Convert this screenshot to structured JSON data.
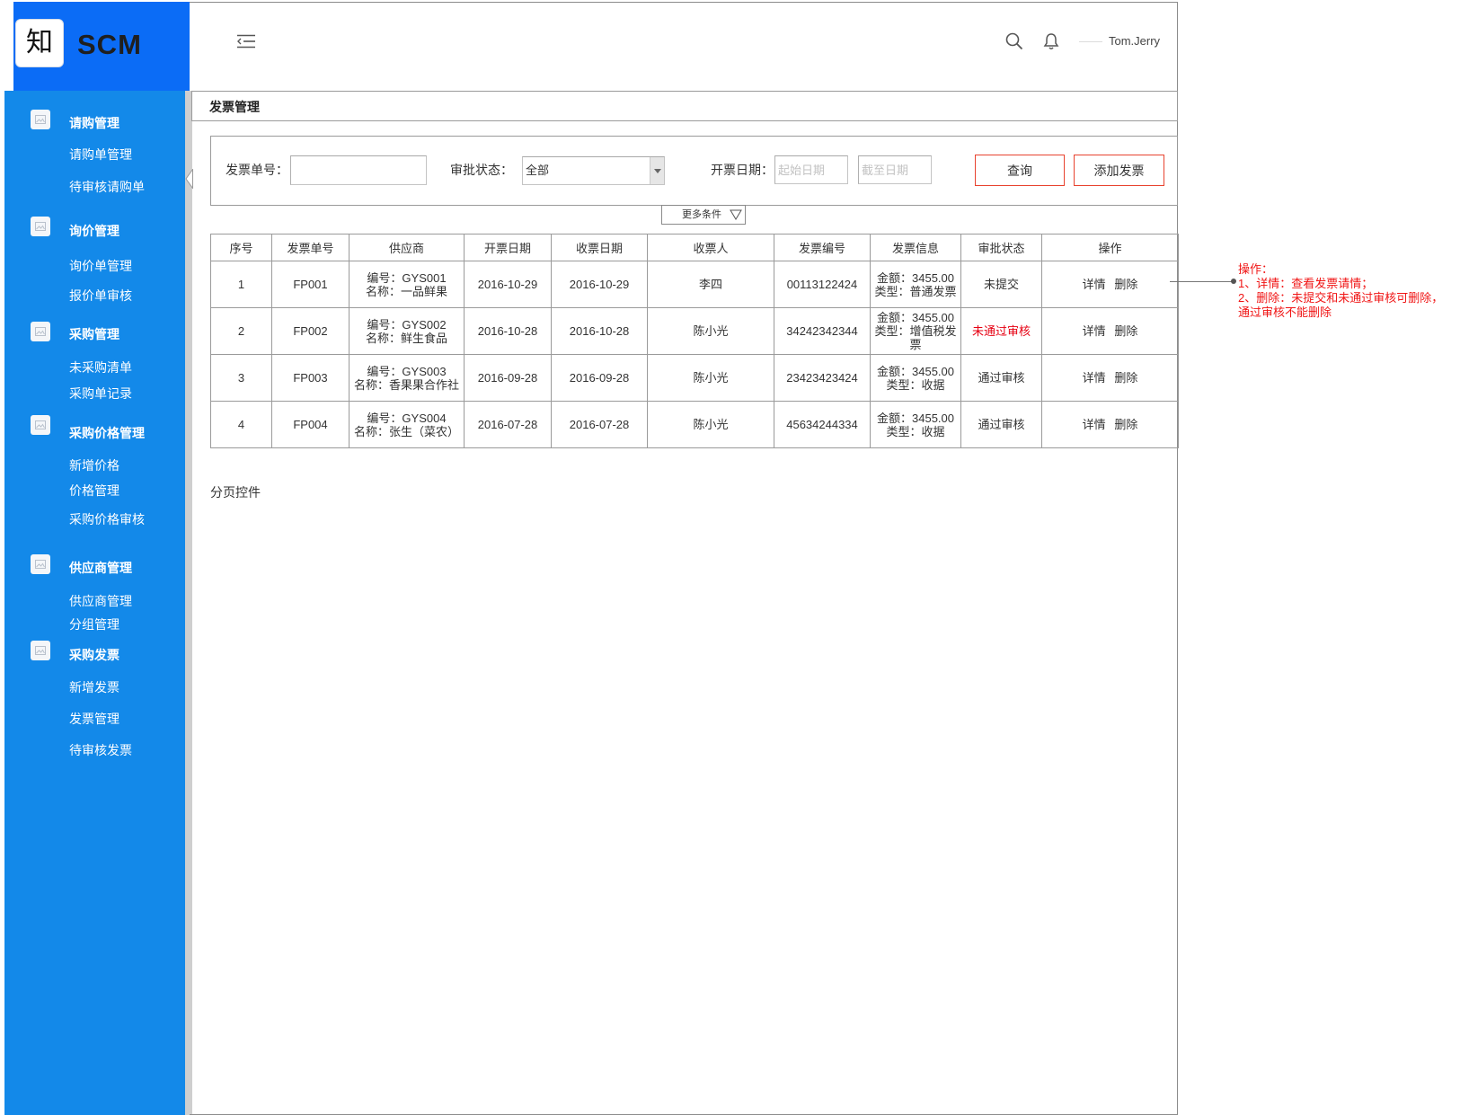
{
  "app": {
    "logo_char": "知",
    "name": "SCM"
  },
  "header": {
    "user_name": "Tom.Jerry",
    "icons": [
      "menu-fold-icon",
      "search-icon",
      "bell-icon"
    ]
  },
  "sidebar": {
    "icon": "image-placeholder-icon",
    "groups": [
      {
        "label": "请购管理",
        "items": [
          "请购单管理",
          "待审核请购单"
        ]
      },
      {
        "label": "询价管理",
        "items": [
          "询价单管理",
          "报价单审核"
        ]
      },
      {
        "label": "采购管理",
        "items": [
          "未采购清单",
          "采购单记录"
        ]
      },
      {
        "label": "采购价格管理",
        "items": [
          "新增价格",
          "价格管理",
          "采购价格审核"
        ]
      },
      {
        "label": "供应商管理",
        "items": [
          "供应商管理",
          "分组管理"
        ]
      },
      {
        "label": "采购发票",
        "items": [
          "新增发票",
          "发票管理",
          "待审核发票"
        ]
      }
    ]
  },
  "page": {
    "title": "发票管理"
  },
  "filters": {
    "invoice_no": {
      "label": "发票单号："
    },
    "approval_status": {
      "label": "审批状态：",
      "value": "全部"
    },
    "invoice_date": {
      "label": "开票日期：",
      "start_placeholder": "起始日期",
      "end_placeholder": "截至日期"
    },
    "query_label": "查询",
    "add_label": "添加发票",
    "more_label": "更多条件"
  },
  "table": {
    "columns": [
      "序号",
      "发票单号",
      "供应商",
      "开票日期",
      "收票日期",
      "收票人",
      "发票编号",
      "发票信息",
      "审批状态",
      "操作"
    ],
    "rows": [
      {
        "index": 1,
        "invoice_no": "FP001",
        "supplier_code": "编号：GYS001",
        "supplier_name": "名称：一品鲜果",
        "issue_date": "2016-10-29",
        "receive_date": "2016-10-29",
        "receiver": "李四",
        "invoice_number": "00113122424",
        "amount": "金额：3455.00",
        "type": "类型：普通发票",
        "status": "未提交",
        "status_color": "#333333",
        "actions": [
          "详情",
          "删除"
        ]
      },
      {
        "index": 2,
        "invoice_no": "FP002",
        "supplier_code": "编号：GYS002",
        "supplier_name": "名称：鲜生食品",
        "issue_date": "2016-10-28",
        "receive_date": "2016-10-28",
        "receiver": "陈小光",
        "invoice_number": "34242342344",
        "amount": "金额：3455.00",
        "type": "类型：增值税发票",
        "status": "未通过审核",
        "status_color": "#e60012",
        "actions": [
          "详情",
          "删除"
        ]
      },
      {
        "index": 3,
        "invoice_no": "FP003",
        "supplier_code": "编号：GYS003",
        "supplier_name": "名称：香果果合作社",
        "issue_date": "2016-09-28",
        "receive_date": "2016-09-28",
        "receiver": "陈小光",
        "invoice_number": "23423423424",
        "amount": "金额：3455.00",
        "type": "类型：收据",
        "status": "通过审核",
        "status_color": "#333333",
        "actions": [
          "详情",
          "删除"
        ]
      },
      {
        "index": 4,
        "invoice_no": "FP004",
        "supplier_code": "编号：GYS004",
        "supplier_name": "名称：张生（菜农）",
        "issue_date": "2016-07-28",
        "receive_date": "2016-07-28",
        "receiver": "陈小光",
        "invoice_number": "45634244334",
        "amount": "金额：3455.00",
        "type": "类型：收据",
        "status": "通过审核",
        "status_color": "#333333",
        "actions": [
          "详情",
          "删除"
        ]
      }
    ]
  },
  "pagination": {
    "label": "分页控件"
  },
  "annotation": {
    "lines": [
      "操作：",
      "1、详情：查看发票请情；",
      "2、删除：未提交和未通过审核可删除，",
      "通过审核不能删除"
    ]
  },
  "theme": {
    "brand": "#0b6cf6",
    "sidebar": "#1389e9",
    "button_border": "#e8432f",
    "annotation": "#f01515"
  }
}
